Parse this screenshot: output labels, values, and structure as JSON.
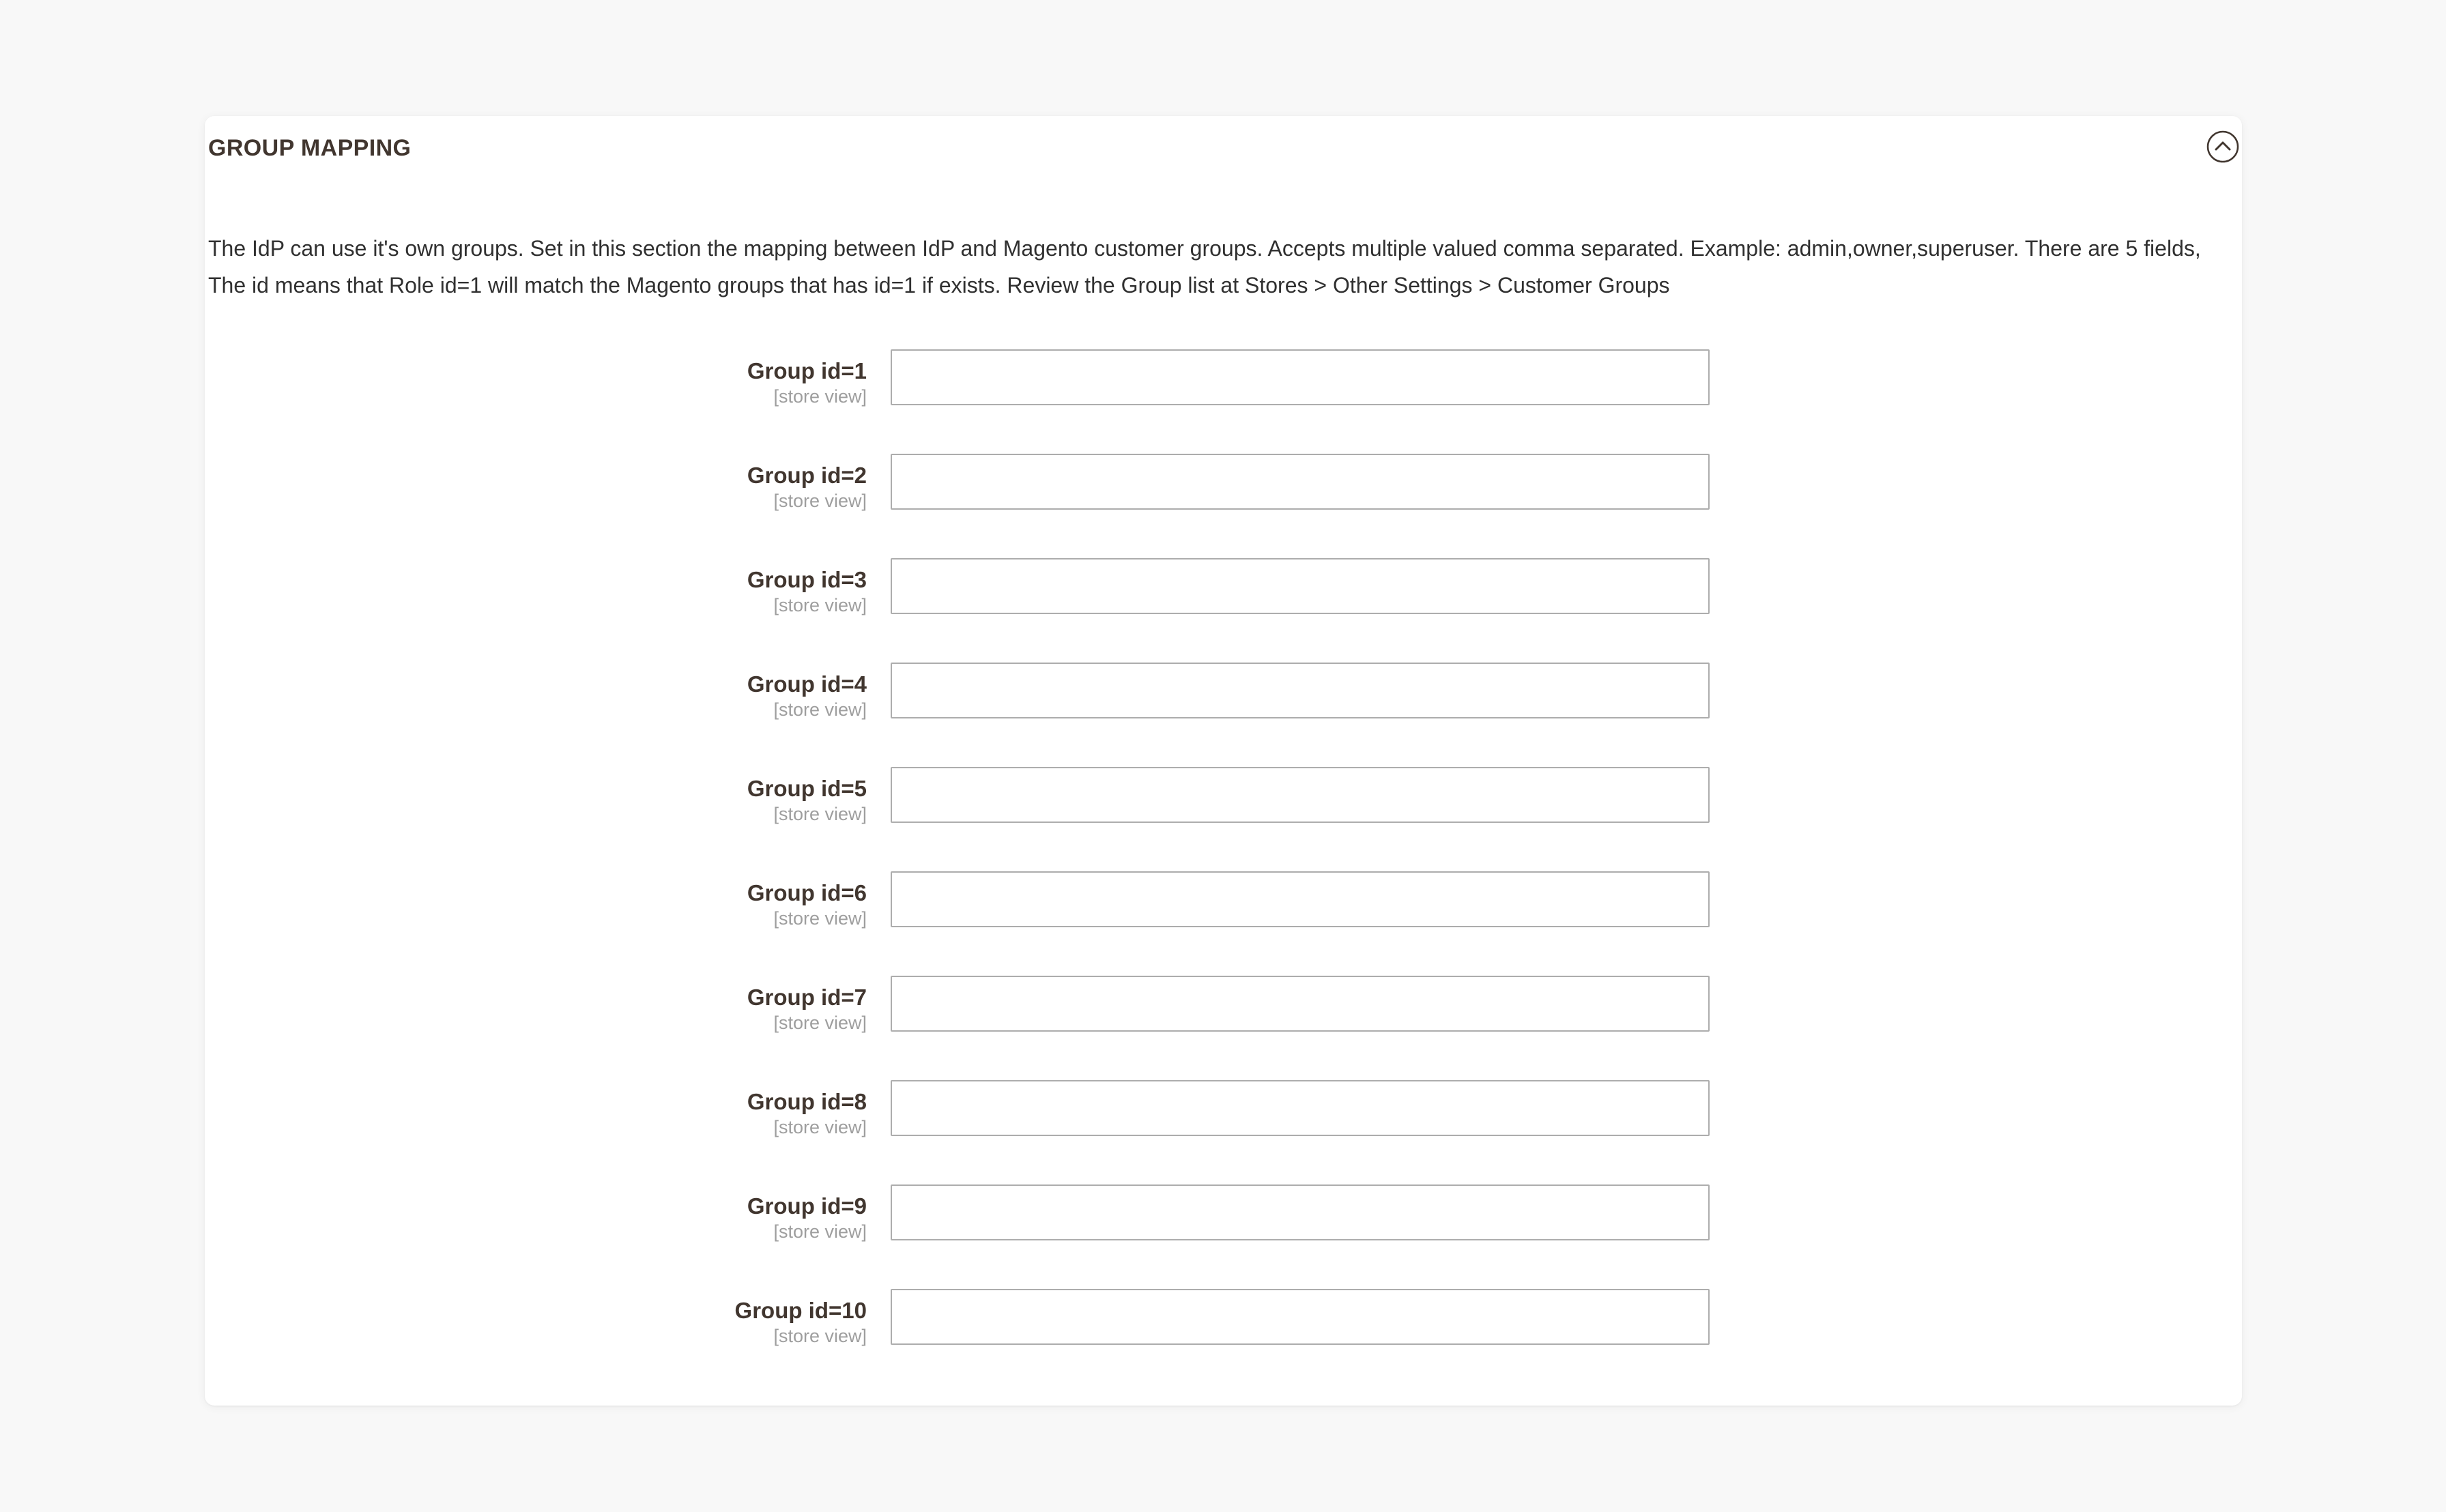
{
  "panel": {
    "title": "GROUP MAPPING",
    "collapse_icon": "chevron-up-circle-icon",
    "description": "The IdP can use it's own groups. Set in this section the mapping between IdP and Magento customer groups. Accepts multiple valued comma separated. Example: admin,owner,superuser. There are 5 fields, The id means that Role id=1 will match the Magento groups that has id=1 if exists. Review the Group list at Stores > Other Settings > Customer Groups",
    "colors": {
      "panel_background": "#ffffff",
      "page_background": "#f8f8f8",
      "label_text": "#41362f",
      "scope_text": "#9e9e9e",
      "body_text": "#303030",
      "input_border": "#adadad"
    }
  },
  "fields": [
    {
      "label": "Group id=1",
      "scope": "[store view]",
      "value": "",
      "placeholder": ""
    },
    {
      "label": "Group id=2",
      "scope": "[store view]",
      "value": "",
      "placeholder": ""
    },
    {
      "label": "Group id=3",
      "scope": "[store view]",
      "value": "",
      "placeholder": ""
    },
    {
      "label": "Group id=4",
      "scope": "[store view]",
      "value": "",
      "placeholder": ""
    },
    {
      "label": "Group id=5",
      "scope": "[store view]",
      "value": "",
      "placeholder": ""
    },
    {
      "label": "Group id=6",
      "scope": "[store view]",
      "value": "",
      "placeholder": ""
    },
    {
      "label": "Group id=7",
      "scope": "[store view]",
      "value": "",
      "placeholder": ""
    },
    {
      "label": "Group id=8",
      "scope": "[store view]",
      "value": "",
      "placeholder": ""
    },
    {
      "label": "Group id=9",
      "scope": "[store view]",
      "value": "",
      "placeholder": ""
    },
    {
      "label": "Group id=10",
      "scope": "[store view]",
      "value": "",
      "placeholder": ""
    }
  ]
}
